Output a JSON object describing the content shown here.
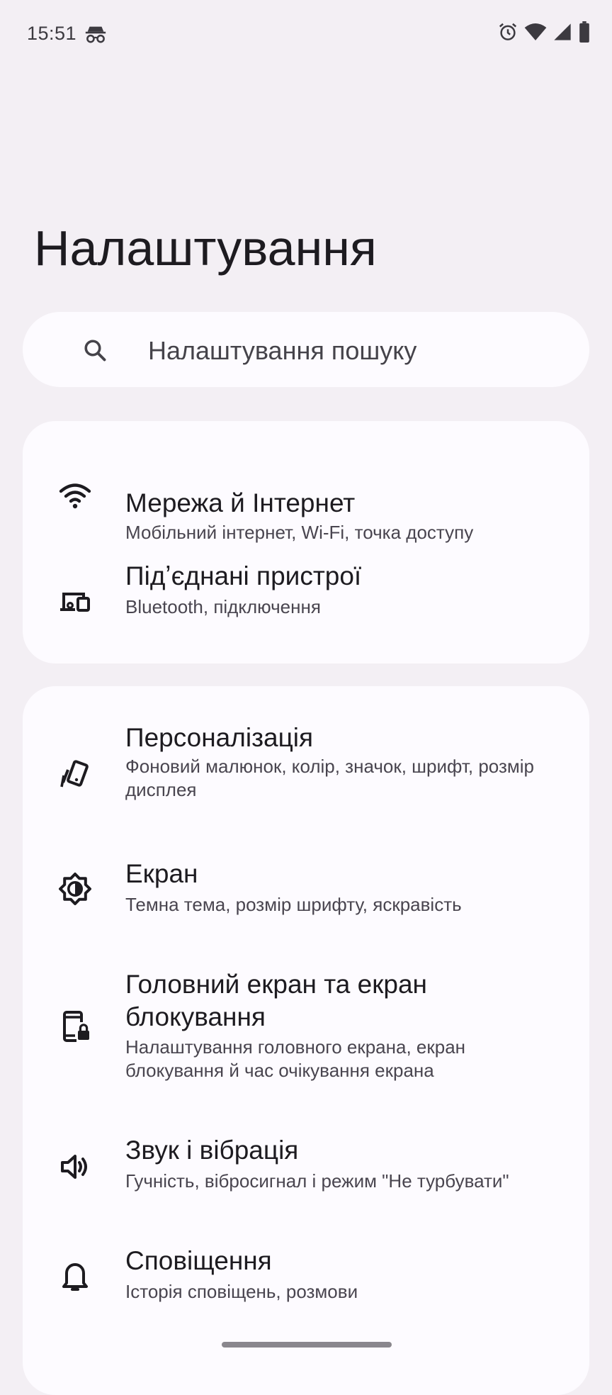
{
  "status_bar": {
    "time": "15:51",
    "icons": [
      "incognito-icon",
      "alarm-icon",
      "wifi-icon",
      "cell-signal-icon",
      "battery-icon"
    ]
  },
  "header": {
    "title": "Налаштування"
  },
  "search": {
    "placeholder": "Налаштування пошуку",
    "icon": "search-icon"
  },
  "groups": [
    {
      "items": [
        {
          "icon": "wifi-icon",
          "title": "Мережа й Інтернет",
          "subtitle": "Мобільний інтернет, Wi-Fi, точка доступу"
        },
        {
          "icon": "connected-devices-icon",
          "title": "Підʼєднані пристрої",
          "subtitle": "Bluetooth, підключення"
        }
      ]
    },
    {
      "items": [
        {
          "icon": "palette-icon",
          "title": "Персоналізація",
          "subtitle": "Фоновий малюнок, колір, значок, шрифт, розмір дисплея"
        },
        {
          "icon": "brightness-icon",
          "title": "Екран",
          "subtitle": "Темна тема, розмір шрифту, яскравість"
        },
        {
          "icon": "lock-screen-icon",
          "title": "Головний екран та екран блокування",
          "subtitle": "Налаштування головного екрана, екран блокування й час очікування екрана"
        },
        {
          "icon": "volume-icon",
          "title": "Звук і вібрація",
          "subtitle": "Гучність, вібросигнал і режим \"Не турбувати\""
        },
        {
          "icon": "bell-icon",
          "title": "Сповіщення",
          "subtitle": "Історія сповіщень, розмови"
        }
      ]
    }
  ],
  "colors": {
    "background": "#f3eff4",
    "card": "#fdfbff",
    "text_primary": "#1d1b20",
    "text_secondary": "#49454f"
  }
}
